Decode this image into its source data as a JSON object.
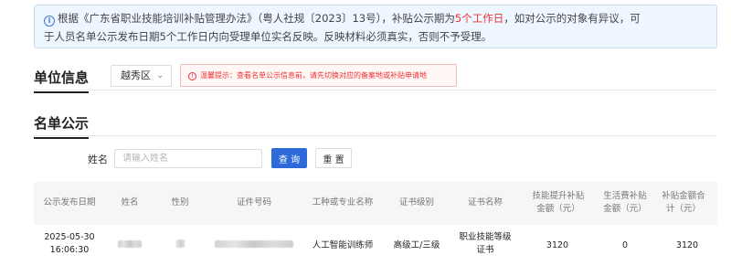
{
  "notice": {
    "line1_before": "根据《广东省职业技能培训补贴管理办法》（粤人社规〔2023〕13号），补贴公示期为",
    "line1_highlight": "5个工作日",
    "line1_after": "，如对公示的对象有异议，可",
    "line2": "于人员名单公示发布日期5个工作日内向受理单位实名反映。反映材料必须真实，否则不予受理。"
  },
  "unit_section": {
    "title": "单位信息",
    "district_selected": "越秀区",
    "tip_text": "温馨提示：查看名单公示信息前，请先切换对应的备案地或补贴申请地"
  },
  "list_section": {
    "title": "名单公示",
    "search_label": "姓名",
    "search_placeholder": "请输入姓名",
    "search_value": "",
    "query_button": "查 询",
    "reset_button": "重 置"
  },
  "table": {
    "headers": {
      "date": "公示发布日期",
      "name": "姓名",
      "gender": "性别",
      "cert_no": "证件号码",
      "trade": "工种或专业名称",
      "level": "证书级别",
      "cert_name_l1": "证书名称",
      "skill_l1": "技能提升补贴",
      "skill_l2": "金额（元）",
      "living_l1": "生活费补贴",
      "living_l2": "金额（元）",
      "total_l1": "补贴金额合",
      "total_l2": "计（元）"
    },
    "rows": [
      {
        "date": "2025-05-30",
        "time": "16:06:30",
        "trade": "人工智能训练师",
        "level": "高级工/三级",
        "cert_l1": "职业技能等级",
        "cert_l2": "证书",
        "skill_amount": "3120",
        "living_amount": "0",
        "total_amount": "3120"
      }
    ]
  },
  "colors": {
    "primary": "#2e6ad9",
    "highlight": "#e33333",
    "notice_bg": "#eef6ff"
  }
}
